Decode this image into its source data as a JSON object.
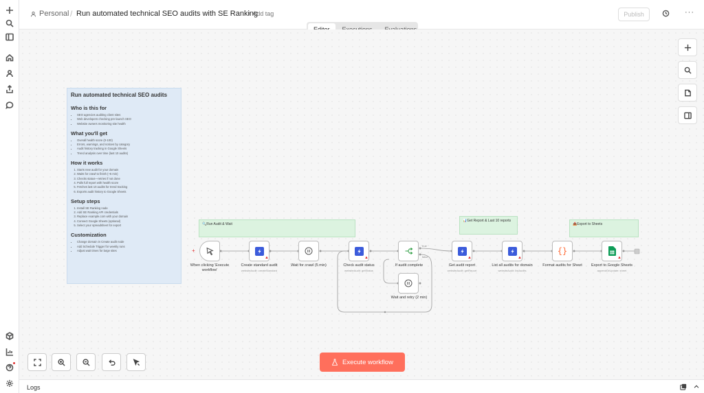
{
  "header": {
    "workspace": "Personal",
    "separator": "/",
    "title": "Run automated technical SEO audits with SE Ranking",
    "add_tag": "+ Add tag",
    "publish": "Publish"
  },
  "tabs": [
    {
      "label": "Editor",
      "active": true
    },
    {
      "label": "Executions",
      "active": false
    },
    {
      "label": "Evaluations",
      "active": false
    }
  ],
  "sticky_main": {
    "title": "Run automated technical SEO audits",
    "sections": [
      {
        "heading": "Who is this for",
        "items": [
          "SEO agencies auditing client sites",
          "Web developers checking pre-launch SEO",
          "Website owners monitoring site health"
        ]
      },
      {
        "heading": "What you'll get",
        "items": [
          "Overall health score (0-100)",
          "Errors, warnings, and notices by category",
          "Audit history tracking in Google Sheets",
          "Trend analysis over time (last 10 audits)"
        ]
      },
      {
        "heading": "How it works",
        "items": [
          "Starts new audit for your domain",
          "Waits for crawl to finish (~5 min)",
          "Checks status—retries if not done",
          "Pulls full report with health score",
          "Fetches last 10 audits for trend tracking",
          "Exports audit history to Google Sheets"
        ]
      },
      {
        "heading": "Setup steps",
        "items": [
          "Install SE Ranking node",
          "Add SE Ranking API credentials",
          "Replace example.com with your domain",
          "Connect Google Sheets (optional)",
          "Select your spreadsheet for export"
        ]
      },
      {
        "heading": "Customization",
        "items": [
          "Change domain in Create audit node",
          "Add Schedule Trigger for weekly runs",
          "Adjust wait times for large sites"
        ]
      }
    ]
  },
  "stickies": {
    "run_audit": "🔍Run Audit & Wait",
    "get_report": "📊Get Report & Last 10 reports",
    "export": "📤Export to Sheets"
  },
  "nodes": {
    "trigger": {
      "label": "When clicking 'Execute workflow'"
    },
    "create_audit": {
      "label": "Create standard audit",
      "sub": "websiteAudit: createStandard"
    },
    "wait_crawl": {
      "label": "Wait for crawl (5 min)"
    },
    "check_status": {
      "label": "Check audit status",
      "sub": "websiteAudit: getStatus"
    },
    "if_complete": {
      "label": "If audit complete",
      "true_label": "true",
      "false_label": "false"
    },
    "wait_retry": {
      "label": "Wait and retry (2 min)"
    },
    "get_report": {
      "label": "Get audit report",
      "sub": "websiteAudit: getReport"
    },
    "list_audits": {
      "label": "List all audits for domain",
      "sub": "websiteAudit: listAudits"
    },
    "format": {
      "label": "Format audits for Sheet"
    },
    "export": {
      "label": "Export to Google Sheets",
      "sub": "appendOrUpdate: sheet"
    }
  },
  "execute_button": "Execute workflow",
  "logs": "Logs",
  "colors": {
    "accent": "#ff6f5c",
    "se_blue": "#3b5bdb",
    "sheets_green": "#0f9d58",
    "code_orange": "#ff6d3a"
  }
}
